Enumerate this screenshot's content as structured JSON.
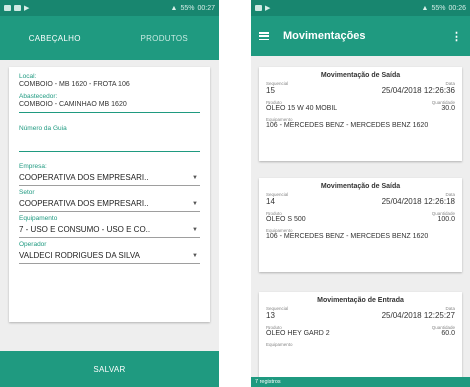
{
  "status_left": {
    "time": "00:27",
    "battery": "55%"
  },
  "status_right": {
    "time": "00:26",
    "battery": "55%"
  },
  "form": {
    "tabs": [
      "CABEÇALHO",
      "PRODUTOS"
    ],
    "local_label": "Local:",
    "local_value": "COMBOIO - MB 1620 - FROTA 106",
    "abastecedor_label": "Abastecedor:",
    "abastecedor_value": "COMBOIO - CAMINHAO MB 1620",
    "guia_label": "Número da Guia",
    "guia_value": "",
    "empresa_label": "Empresa:",
    "empresa_value": "COOPERATIVA DOS EMPRESARI..",
    "setor_label": "Setor",
    "setor_value": "COOPERATIVA DOS EMPRESARI..",
    "equipamento_label": "Equipamento",
    "equipamento_value": "7 - USO E CONSUMO - USO E CO..",
    "operador_label": "Operador",
    "operador_value": "VALDECI RODRIGUES DA SILVA",
    "save_label": "SALVAR"
  },
  "list": {
    "title": "Movimentações",
    "labels": {
      "sequencial": "Sequencial",
      "data": "Data",
      "produto": "Produto",
      "quantidade": "Quantidade",
      "equipamento": "Equipamento"
    },
    "items": [
      {
        "type": "Movimentação de Saída",
        "seq": "15",
        "date": "25/04/2018 12:26:36",
        "product": "ÓLEO 15 W 40 MOBIL",
        "qty": "30.0",
        "equip": "106 - MERCEDES BENZ - MERCEDES BENZ 1620"
      },
      {
        "type": "Movimentação de Saída",
        "seq": "14",
        "date": "25/04/2018 12:26:18",
        "product": "ÓLEO S 500",
        "qty": "100.0",
        "equip": "106 - MERCEDES BENZ - MERCEDES BENZ 1620"
      },
      {
        "type": "Movimentação de Entrada",
        "seq": "13",
        "date": "25/04/2018 12:25:27",
        "product": "ÓLEO HEY GARD 2",
        "qty": "60.0",
        "equip": ""
      }
    ],
    "footer": "7 registros"
  },
  "colors": {
    "primary": "#1f9a80",
    "status": "#18866f"
  }
}
